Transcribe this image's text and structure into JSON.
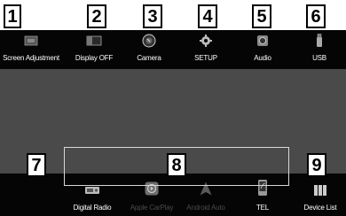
{
  "callouts": [
    "1",
    "2",
    "3",
    "4",
    "5",
    "6",
    "7",
    "8",
    "9"
  ],
  "top_menu": [
    {
      "label": "Screen Adjustment",
      "icon": "screen-adjustment-icon"
    },
    {
      "label": "Display OFF",
      "icon": "display-off-icon"
    },
    {
      "label": "Camera",
      "icon": "camera-icon"
    },
    {
      "label": "SETUP",
      "icon": "gear-icon"
    },
    {
      "label": "Audio",
      "icon": "speaker-icon"
    },
    {
      "label": "USB",
      "icon": "usb-icon"
    }
  ],
  "bottom_menu": {
    "close_label": "×",
    "sources": [
      {
        "label": "Digital Radio",
        "icon": "radio-icon",
        "enabled": true
      },
      {
        "label": "Apple CarPlay",
        "icon": "carplay-icon",
        "enabled": false
      },
      {
        "label": "Android Auto",
        "icon": "android-auto-icon",
        "enabled": false
      },
      {
        "label": "TEL",
        "icon": "phone-icon",
        "enabled": true
      }
    ],
    "device_list_label": "Device List",
    "device_list_icon": "device-list-icon"
  },
  "colors": {
    "bar": "#050505",
    "screen": "#4a4a4a",
    "label": "#ffffff",
    "disabled": "#4a4a4a"
  }
}
